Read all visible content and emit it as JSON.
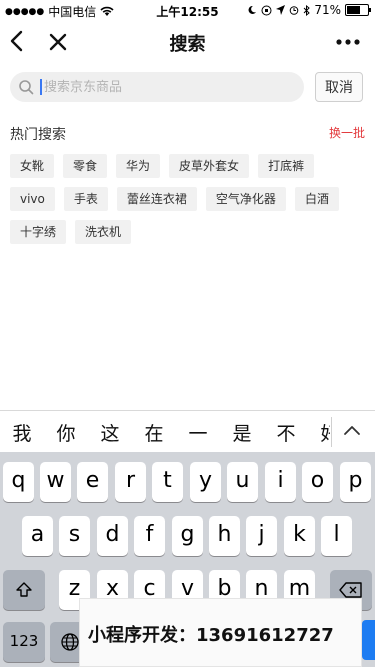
{
  "status_bar": {
    "carrier": "中国电信",
    "time": "上午12:55",
    "battery_text": "71%",
    "battery_level": 0.71
  },
  "navbar": {
    "title": "搜索",
    "back_icon": "chevron-left-icon",
    "close_icon": "close-icon",
    "more_icon": "more-dots-icon"
  },
  "search": {
    "placeholder": "搜索京东商品",
    "value": "",
    "cancel_label": "取消"
  },
  "hot": {
    "title": "热门搜索",
    "refresh_label": "换一批",
    "refresh_color": "#e3393c",
    "rows": [
      [
        "女靴",
        "零食",
        "华为",
        "皮草外套女",
        "打底裤"
      ],
      [
        "vivo",
        "手表",
        "蕾丝连衣裙",
        "空气净化器",
        "白酒"
      ],
      [
        "十字绣",
        "洗衣机"
      ]
    ]
  },
  "keyboard": {
    "candidates": [
      "我",
      "你",
      "这",
      "在",
      "一",
      "是",
      "不",
      "好"
    ],
    "row1": [
      "q",
      "w",
      "e",
      "r",
      "t",
      "y",
      "u",
      "i",
      "o",
      "p"
    ],
    "row2": [
      "a",
      "s",
      "d",
      "f",
      "g",
      "h",
      "j",
      "k",
      "l"
    ],
    "row3": [
      "z",
      "x",
      "c",
      "v",
      "b",
      "n",
      "m"
    ],
    "numbers_label": "123"
  },
  "promo": {
    "text": "小程序开发：13691612727"
  }
}
